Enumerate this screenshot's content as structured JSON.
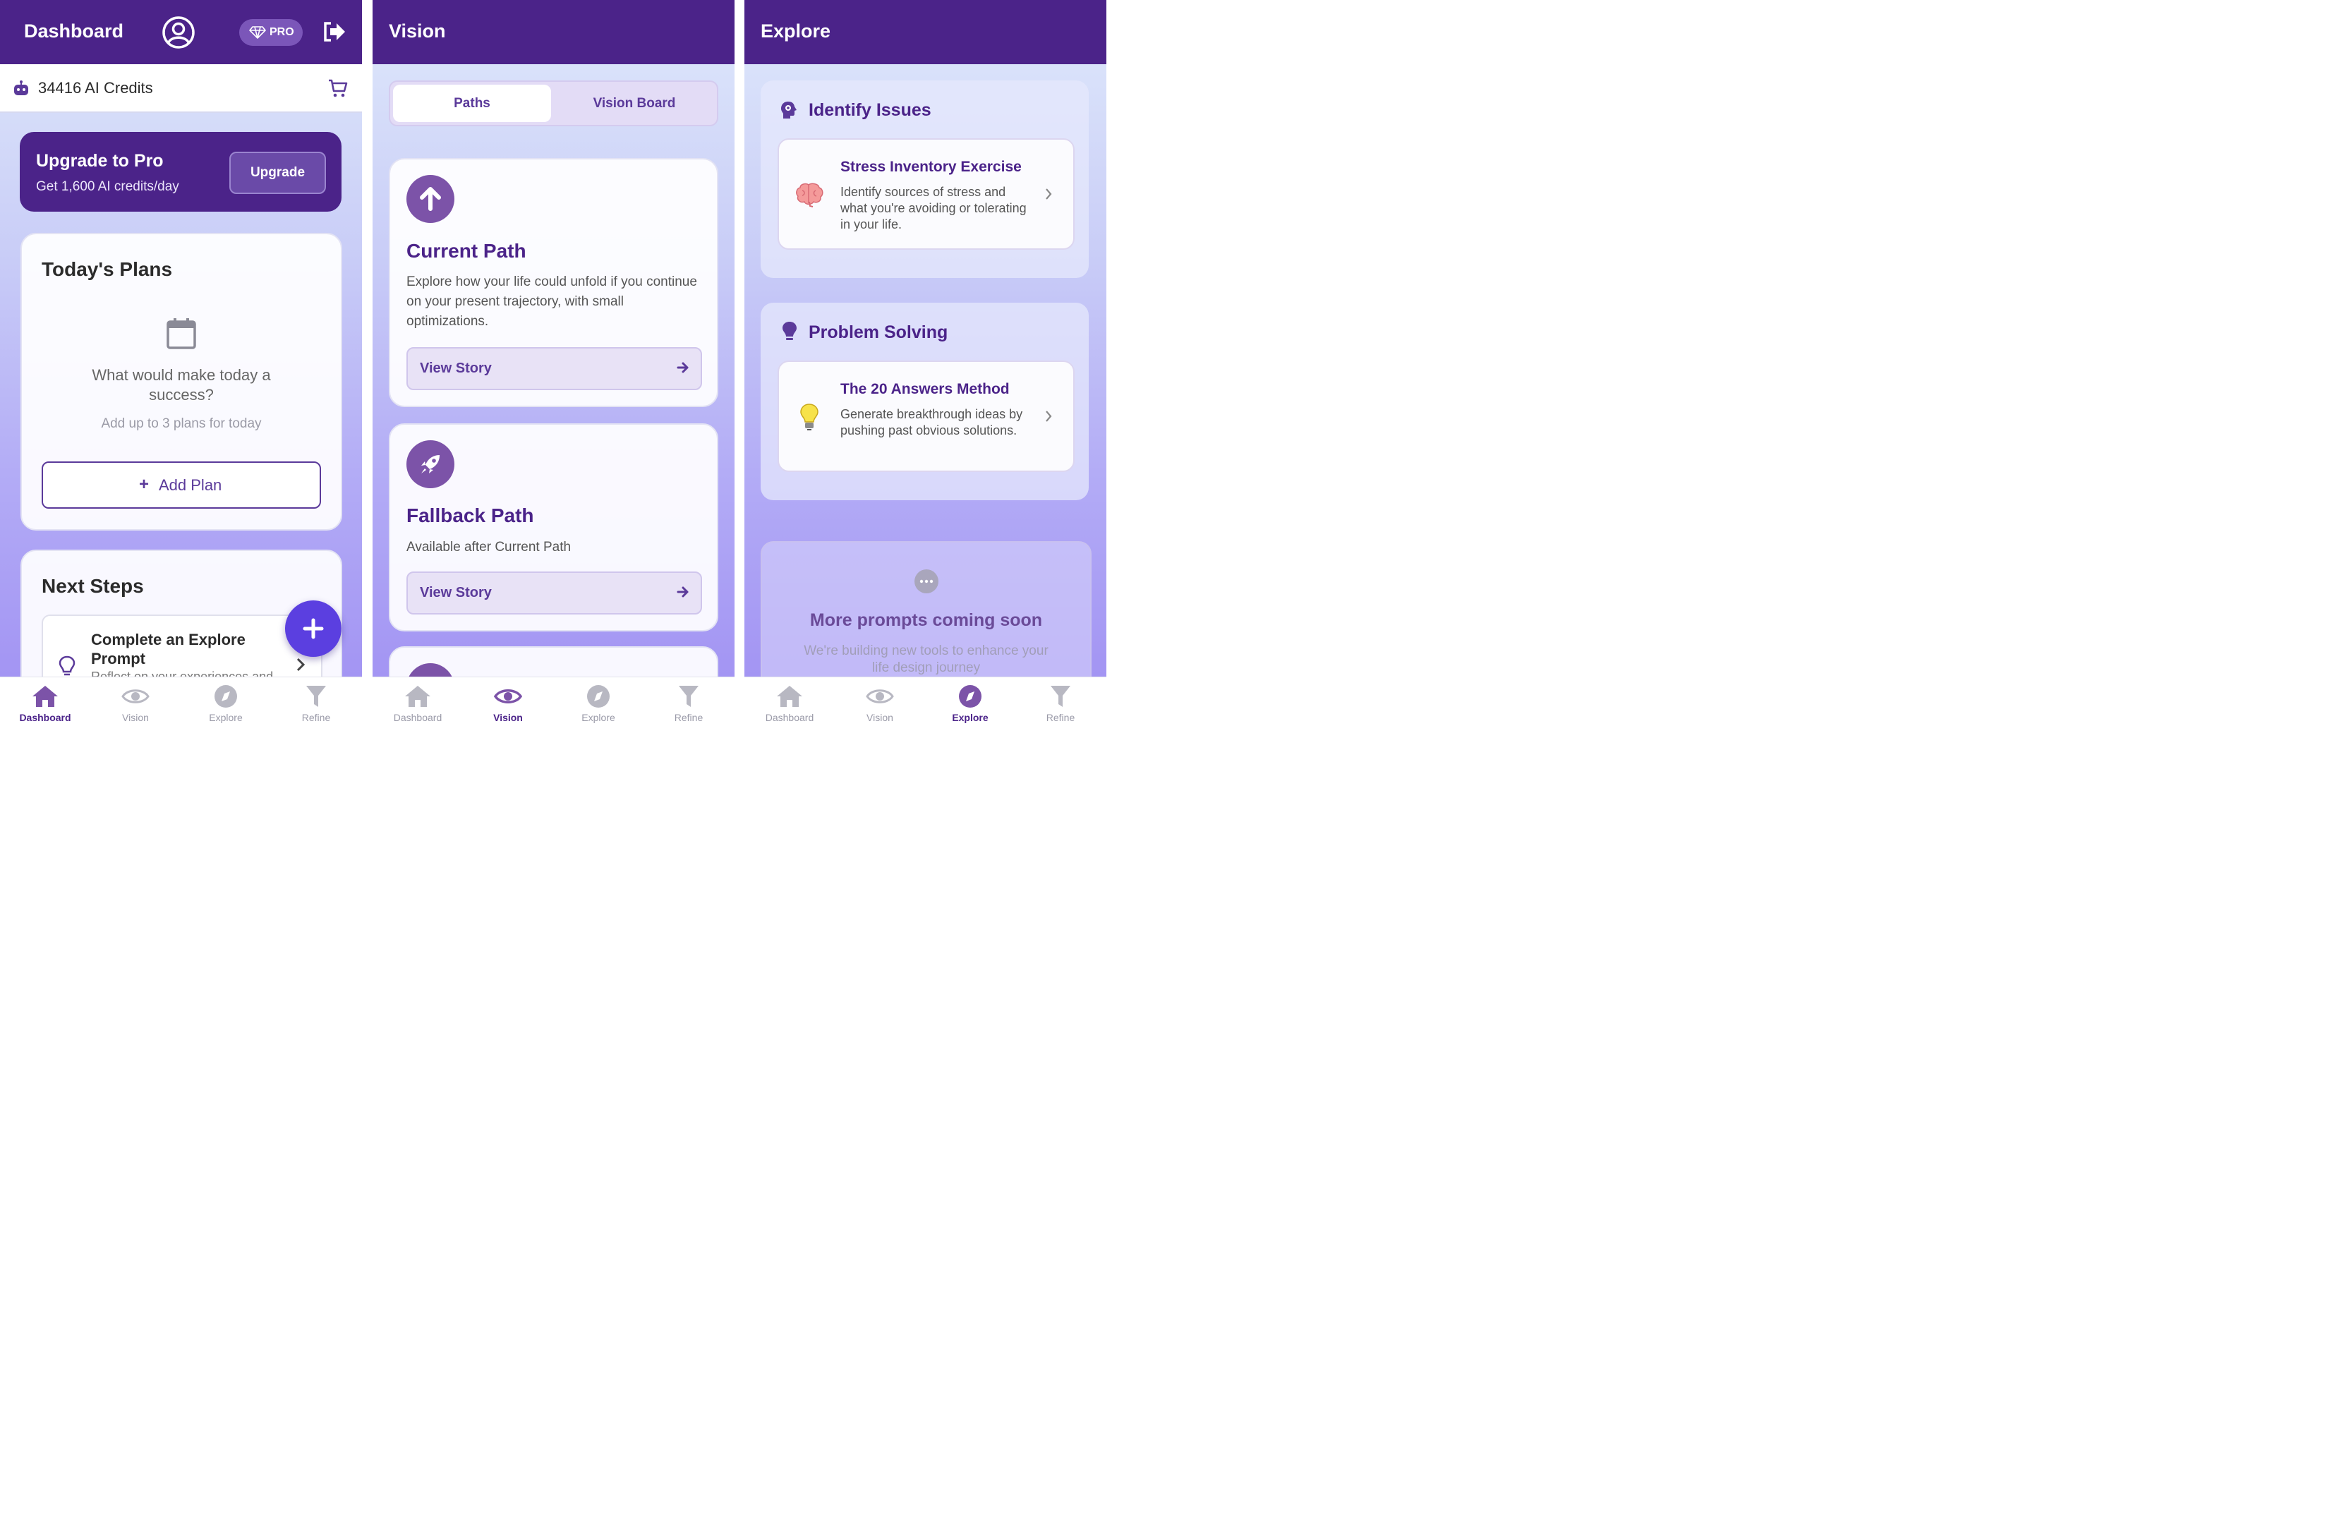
{
  "dashboard": {
    "header": {
      "title": "Dashboard",
      "pro_badge": "PRO"
    },
    "credits": {
      "text": "34416 AI Credits"
    },
    "promo": {
      "title": "Upgrade to Pro",
      "subtitle": "Get 1,600 AI credits/day",
      "button": "Upgrade"
    },
    "plans": {
      "title": "Today's Plans",
      "question": "What would make today a success?",
      "hint": "Add up to 3 plans for today",
      "add_button": "Add Plan"
    },
    "next_steps": {
      "title": "Next Steps",
      "item_title": "Complete an Explore Prompt",
      "item_desc": "Reflect on your experiences and"
    }
  },
  "vision": {
    "header": {
      "title": "Vision"
    },
    "tabs": [
      "Paths",
      "Vision Board"
    ],
    "paths": [
      {
        "title": "Current Path",
        "desc": "Explore how your life could unfold if you continue on your present trajectory, with small optimizations.",
        "button": "View Story",
        "icon": "arrow-up-icon"
      },
      {
        "title": "Fallback Path",
        "desc": "Available after Current Path",
        "button": "View Story",
        "icon": "rocket-icon"
      }
    ]
  },
  "explore": {
    "header": {
      "title": "Explore"
    },
    "sections": [
      {
        "title": "Identify Issues",
        "icon": "head-gear-icon",
        "item": {
          "title": "Stress Inventory Exercise",
          "desc": "Identify sources of stress and what you're avoiding or tolerating in your life.",
          "icon": "brain-icon"
        }
      },
      {
        "title": "Problem Solving",
        "icon": "lightbulb-icon",
        "item": {
          "title": "The 20 Answers Method",
          "desc": "Generate breakthrough ideas by pushing past obvious solutions.",
          "icon": "lightbulb-icon"
        }
      }
    ],
    "coming_soon": {
      "title": "More prompts coming soon",
      "desc": "We're building new tools to enhance your life design journey"
    }
  },
  "nav": {
    "items": [
      "Dashboard",
      "Vision",
      "Explore",
      "Refine"
    ]
  },
  "colors": {
    "primary": "#4b2389",
    "accent": "#5b3fe0",
    "text": "#2b2b2b"
  }
}
